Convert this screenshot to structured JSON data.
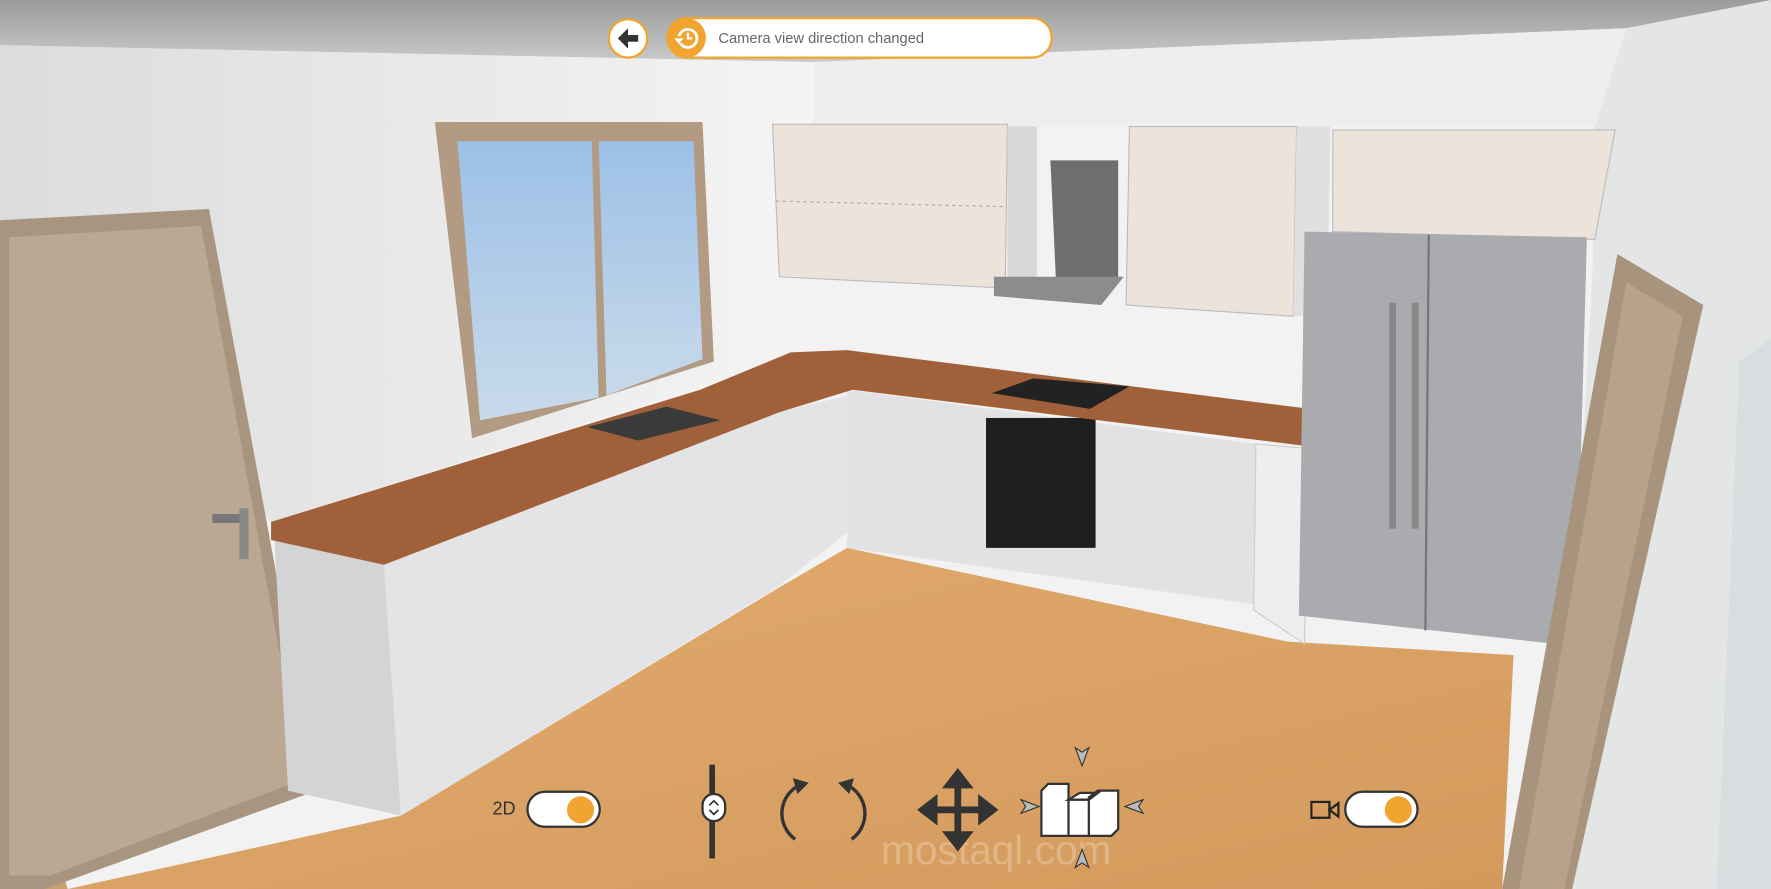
{
  "header": {
    "back_icon": "arrow-left-icon",
    "notification": {
      "icon": "history-clock-icon",
      "text": "Camera view direction changed"
    }
  },
  "controls": {
    "view_2d_label": "2D",
    "view_2d_toggle_on": true,
    "height_slider_icon": "up-down-chevron-icon",
    "rotate_icon": "rotate-arrows-icon",
    "pan_icon": "move-arrows-icon",
    "view_icon": "building-view-icon",
    "camera_icon": "video-camera-icon",
    "camera_toggle_on": true
  },
  "watermark": {
    "text": "mostaql.com"
  },
  "colors": {
    "accent": "#f2a431",
    "dark": "#333333"
  }
}
